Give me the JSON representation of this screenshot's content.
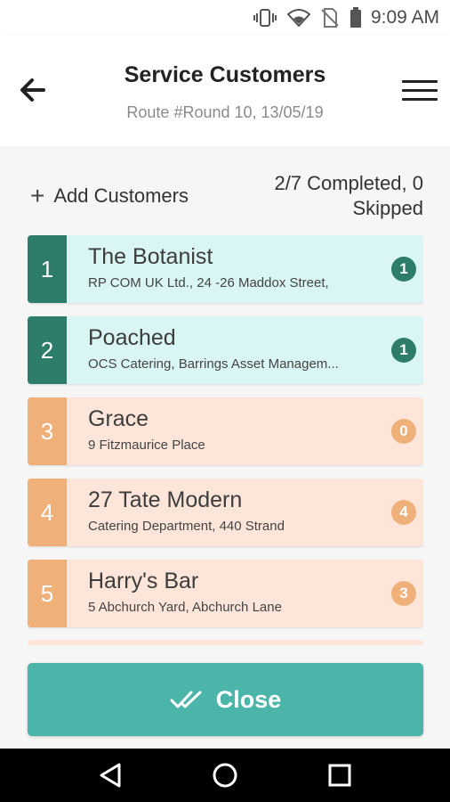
{
  "status_bar": {
    "time": "9:09 AM",
    "icons": [
      "vibrate-icon",
      "wifi-icon",
      "no-sim-icon",
      "battery-icon"
    ]
  },
  "header": {
    "title": "Service Customers",
    "subtitle": "Route #Round 10, 13/05/19",
    "back_icon": "back-arrow-icon",
    "menu_icon": "hamburger-menu-icon"
  },
  "toolbar": {
    "add_label": "Add Customers",
    "summary_line1": "2/7 Completed, 0",
    "summary_line2": "Skipped"
  },
  "customers": [
    {
      "number": "1",
      "name": "The Botanist",
      "address": "RP COM UK Ltd., 24 -26 Maddox Street,",
      "count": "1",
      "status": "done"
    },
    {
      "number": "2",
      "name": "Poached",
      "address": "OCS Catering, Barrings Asset Managem...",
      "count": "1",
      "status": "done"
    },
    {
      "number": "3",
      "name": "Grace",
      "address": "9 Fitzmaurice Place",
      "count": "0",
      "status": "pending"
    },
    {
      "number": "4",
      "name": "27 Tate Modern",
      "address": "Catering Department, 440 Strand",
      "count": "4",
      "status": "pending"
    },
    {
      "number": "5",
      "name": "Harry's Bar",
      "address": "5 Abchurch Yard, Abchurch Lane",
      "count": "3",
      "status": "pending"
    }
  ],
  "close_button": {
    "label": "Close",
    "icon": "double-check-icon"
  },
  "nav_bar": {
    "icons": [
      "nav-back-icon",
      "nav-home-icon",
      "nav-recents-icon"
    ]
  },
  "colors": {
    "done_accent": "#2e7d6b",
    "done_bg": "#d9f6f4",
    "pending_accent": "#efb07a",
    "pending_bg": "#fde6d9",
    "close_button": "#4cb5aa"
  }
}
